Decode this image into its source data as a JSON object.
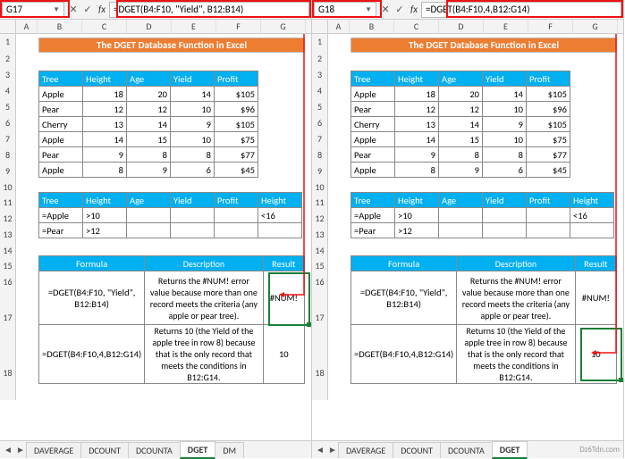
{
  "left": {
    "namebox": "G17",
    "formula": "=DGET(B4:F10, \"Yield\", B12:B14)",
    "result_highlight": "#NUM!"
  },
  "right": {
    "namebox": "G18",
    "formula": "=DGET(B4:F10,4,B12:G14)",
    "result_highlight": "10"
  },
  "banner": "The DGET Database Function in Excel",
  "columns": [
    "A",
    "B",
    "C",
    "D",
    "E",
    "F",
    "G"
  ],
  "rows": [
    "1",
    "2",
    "3",
    "4",
    "5",
    "6",
    "7",
    "8",
    "9",
    "10",
    "11",
    "12",
    "13",
    "14",
    "15",
    "16",
    "17",
    "18"
  ],
  "db_headers": [
    "Tree",
    "Height",
    "Age",
    "Yield",
    "Profit"
  ],
  "db_rows": [
    {
      "tree": "Apple",
      "h": "18",
      "a": "20",
      "y": "14",
      "p": "$105"
    },
    {
      "tree": "Pear",
      "h": "12",
      "a": "12",
      "y": "10",
      "p": "$96"
    },
    {
      "tree": "Cherry",
      "h": "13",
      "a": "14",
      "y": "9",
      "p": "$105"
    },
    {
      "tree": "Apple",
      "h": "14",
      "a": "15",
      "y": "10",
      "p": "$75"
    },
    {
      "tree": "Pear",
      "h": "9",
      "a": "8",
      "y": "8",
      "p": "$77"
    },
    {
      "tree": "Apple",
      "h": "8",
      "a": "9",
      "y": "6",
      "p": "$45"
    }
  ],
  "crit_headers": [
    "Tree",
    "Height",
    "Age",
    "Yield",
    "Profit",
    "Height"
  ],
  "crit_rows": [
    {
      "tree": "=Apple",
      "h": ">10",
      "a": "",
      "y": "",
      "p": "",
      "h2": "<16"
    },
    {
      "tree": "=Pear",
      "h": ">12",
      "a": "",
      "y": "",
      "p": "",
      "h2": ""
    }
  ],
  "res_headers": [
    "Formula",
    "Description",
    "Result"
  ],
  "res_rows": [
    {
      "f": "=DGET(B4:F10, \"Yield\", B12:B14)",
      "d": "Returns the #NUM! error value because more than one record meets the criteria (any apple or pear tree).",
      "r": "#NUM!"
    },
    {
      "f": "=DGET(B4:F10,4,B12:G14)",
      "d": "Returns 10 (the Yield of the apple tree in row 8) because that is the only record that meets the conditions in B12:G14.",
      "r": "10"
    }
  ],
  "tabs": {
    "nav": [
      "◄",
      "►"
    ],
    "items": [
      "DAVERAGE",
      "DCOUNT",
      "DCOUNTA",
      "DGET",
      "DM"
    ],
    "active": "DGET"
  },
  "watermark_left": "",
  "watermark_right": "Dz6Tdn.com"
}
